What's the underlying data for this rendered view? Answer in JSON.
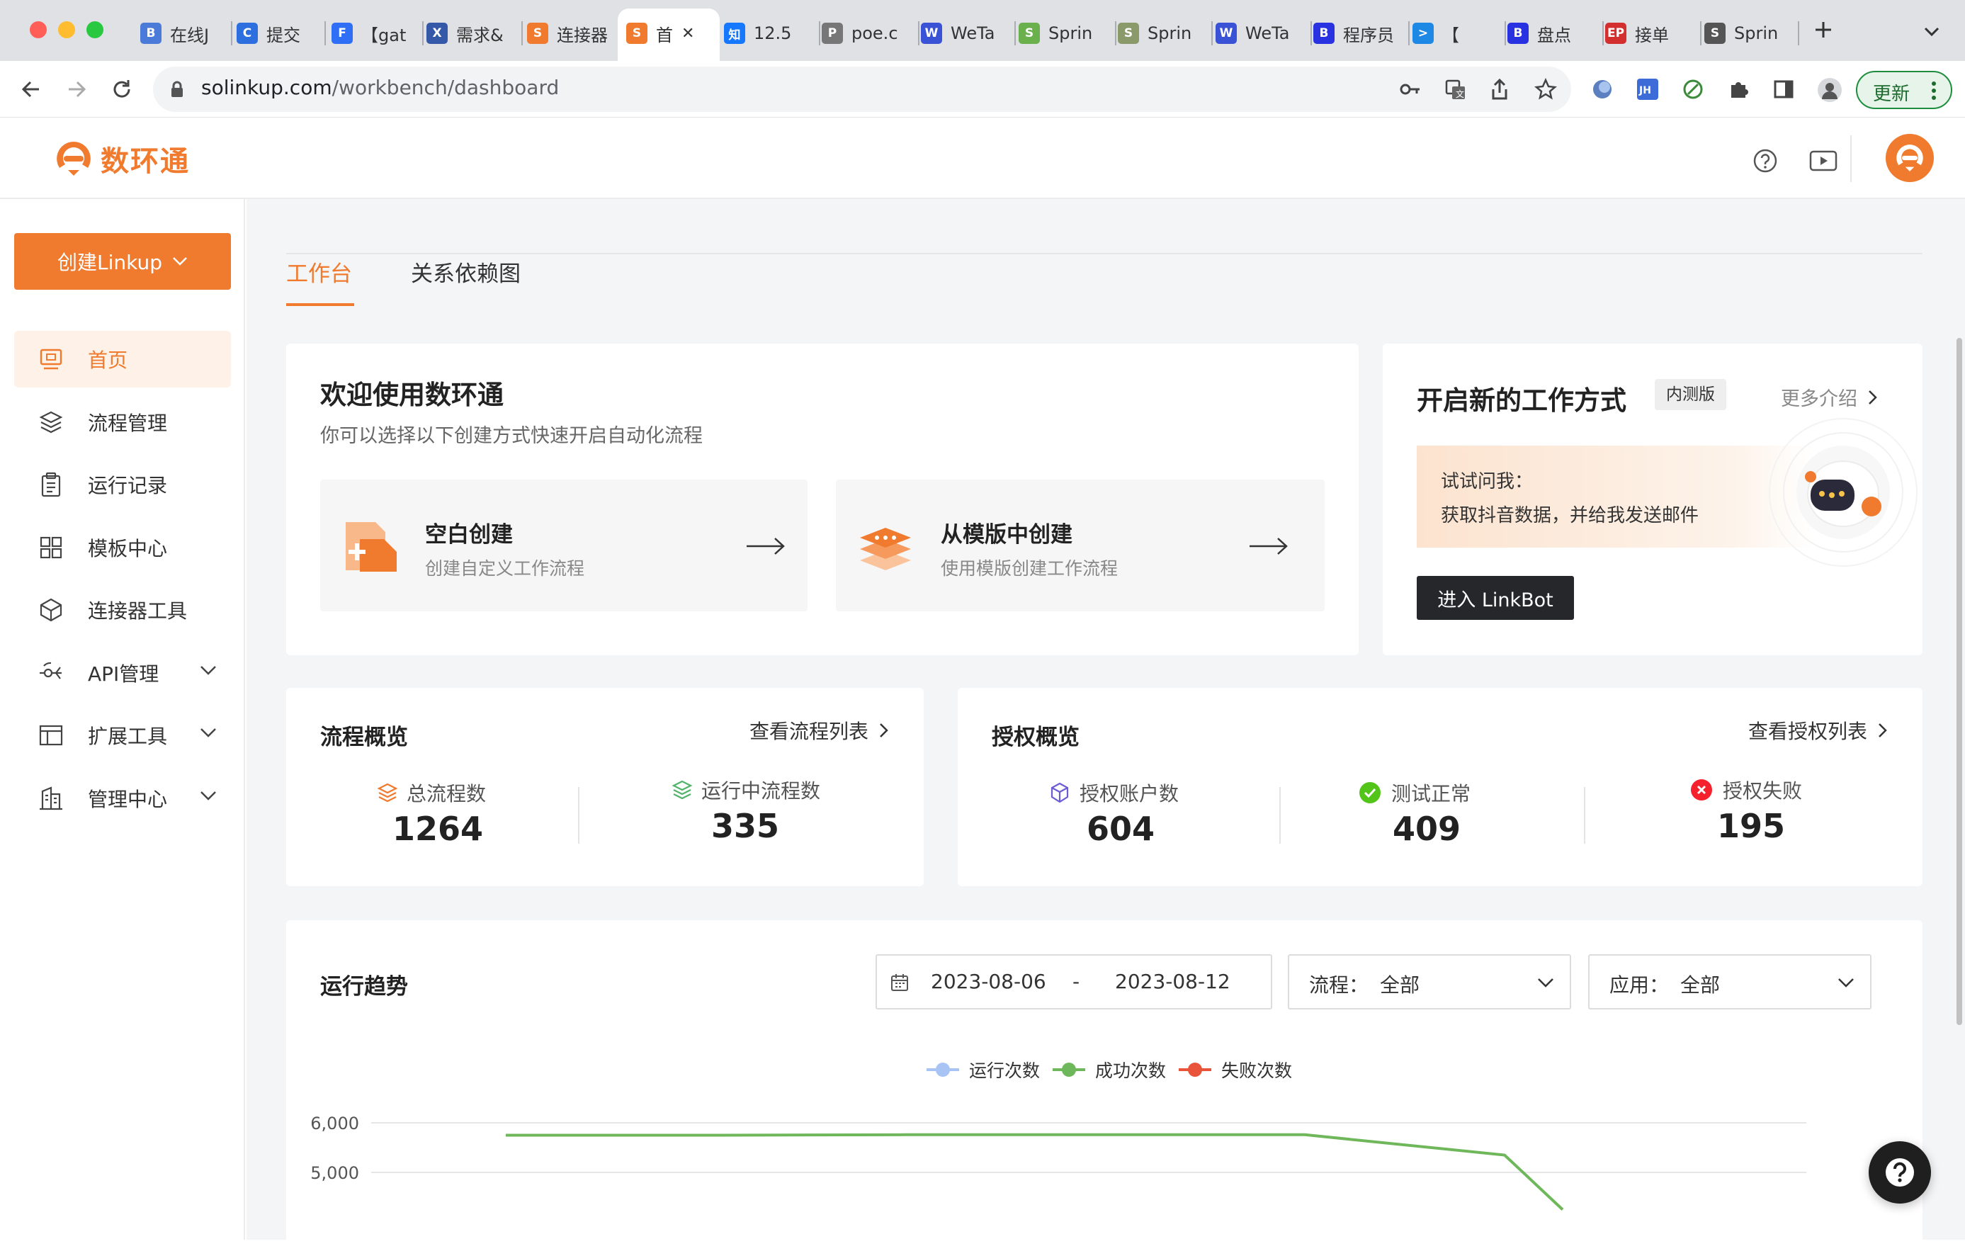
{
  "browser": {
    "tabs": [
      {
        "label": "在线J",
        "color": "#4a7bd8",
        "glyph": "B"
      },
      {
        "label": "提交",
        "color": "#2e6fe0",
        "glyph": "C"
      },
      {
        "label": "【gat",
        "color": "#2f6ff5",
        "glyph": "F"
      },
      {
        "label": "需求&",
        "color": "#3558a8",
        "glyph": "X"
      },
      {
        "label": "连接器",
        "color": "#f07a2e",
        "glyph": "S"
      },
      {
        "label": "首",
        "color": "#f07a2e",
        "glyph": "S"
      },
      {
        "label": "12.5",
        "color": "#1677ff",
        "glyph": "知"
      },
      {
        "label": "poe.c",
        "color": "#777777",
        "glyph": "P"
      },
      {
        "label": "WeTa",
        "color": "#3a53d6",
        "glyph": "W"
      },
      {
        "label": "Sprin",
        "color": "#6ab04c",
        "glyph": "S"
      },
      {
        "label": "Sprin",
        "color": "#8a9a6a",
        "glyph": "S"
      },
      {
        "label": "WeTa",
        "color": "#3a53d6",
        "glyph": "W"
      },
      {
        "label": "程序员",
        "color": "#2932e1",
        "glyph": "B"
      },
      {
        "label": "【",
        "color": "#1e88e5",
        "glyph": ">"
      },
      {
        "label": "盘点",
        "color": "#2932e1",
        "glyph": "B"
      },
      {
        "label": "接单",
        "color": "#d32f2f",
        "glyph": "EP"
      },
      {
        "label": "Sprin",
        "color": "#555555",
        "glyph": "S"
      }
    ],
    "url_domain": "solinkup.com",
    "url_path": "/workbench/dashboard",
    "update_label": "更新"
  },
  "brand": {
    "name": "数环通",
    "color": "#f07a2e"
  },
  "sidebar": {
    "create_label": "创建Linkup",
    "items": [
      {
        "label": "首页",
        "icon": "monitor-icon",
        "active": true
      },
      {
        "label": "流程管理",
        "icon": "layers-icon"
      },
      {
        "label": "运行记录",
        "icon": "clipboard-icon"
      },
      {
        "label": "模板中心",
        "icon": "grid-icon"
      },
      {
        "label": "连接器工具",
        "icon": "cube-icon"
      },
      {
        "label": "API管理",
        "icon": "api-icon",
        "expandable": true
      },
      {
        "label": "扩展工具",
        "icon": "layout-icon",
        "expandable": true
      },
      {
        "label": "管理中心",
        "icon": "building-icon",
        "expandable": true
      }
    ]
  },
  "main": {
    "tabs": [
      "工作台",
      "关系依赖图"
    ],
    "welcome": {
      "title": "欢迎使用数环通",
      "subtitle": "你可以选择以下创建方式快速开启自动化流程",
      "options": [
        {
          "title": "空白创建",
          "desc": "创建自定义工作流程"
        },
        {
          "title": "从模版中创建",
          "desc": "使用模版创建工作流程"
        }
      ]
    },
    "linkbot": {
      "title": "开启新的工作方式",
      "badge": "内测版",
      "more": "更多介绍",
      "prompt_line1": "试试问我：",
      "prompt_line2": "获取抖音数据，并给我发送邮件",
      "button": "进入 LinkBot"
    },
    "flow_overview": {
      "title": "流程概览",
      "link": "查看流程列表",
      "stats": [
        {
          "label": "总流程数",
          "value": "1264"
        },
        {
          "label": "运行中流程数",
          "value": "335"
        }
      ]
    },
    "auth_overview": {
      "title": "授权概览",
      "link": "查看授权列表",
      "stats": [
        {
          "label": "授权账户数",
          "value": "604"
        },
        {
          "label": "测试正常",
          "value": "409"
        },
        {
          "label": "授权失败",
          "value": "195"
        }
      ]
    },
    "trend": {
      "title": "运行趋势",
      "date_start": "2023-08-06",
      "date_sep": "-",
      "date_end": "2023-08-12",
      "flow_filter_label": "流程：",
      "flow_filter_value": "全部",
      "app_filter_label": "应用：",
      "app_filter_value": "全部"
    }
  },
  "chart_data": {
    "type": "line",
    "title": "运行趋势",
    "y_ticks": [
      "6,000",
      "5,000"
    ],
    "series": [
      {
        "name": "运行次数",
        "color": "#a8c4f5",
        "values": []
      },
      {
        "name": "成功次数",
        "color": "#6fb75b",
        "values": [
          5750,
          5750,
          5760,
          5760,
          5760,
          5350,
          4250
        ]
      },
      {
        "name": "失败次数",
        "color": "#e8533a",
        "values": []
      }
    ]
  }
}
